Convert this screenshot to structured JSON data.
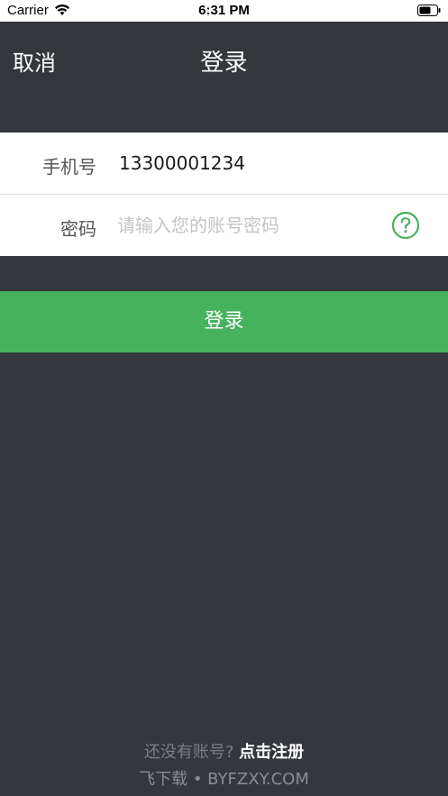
{
  "status_bar": {
    "carrier": "Carrier",
    "time": "6:31 PM",
    "icons": [
      "wifi-icon",
      "battery-icon"
    ]
  },
  "nav": {
    "cancel_label": "取消",
    "title": "登录"
  },
  "form": {
    "phone_label": "手机号",
    "phone_value": "13300001234",
    "password_label": "密码",
    "password_placeholder": "请输入您的账号密码",
    "help_icon": "question-circle-icon"
  },
  "login_button_label": "登录",
  "footer": {
    "register_prompt": "还没有账号?",
    "register_link": "点击注册",
    "watermark": "飞下载 • BYFZXY.COM"
  },
  "colors": {
    "background": "#34373b",
    "accent_green": "#46b25e",
    "card_background": "#ffffff"
  }
}
